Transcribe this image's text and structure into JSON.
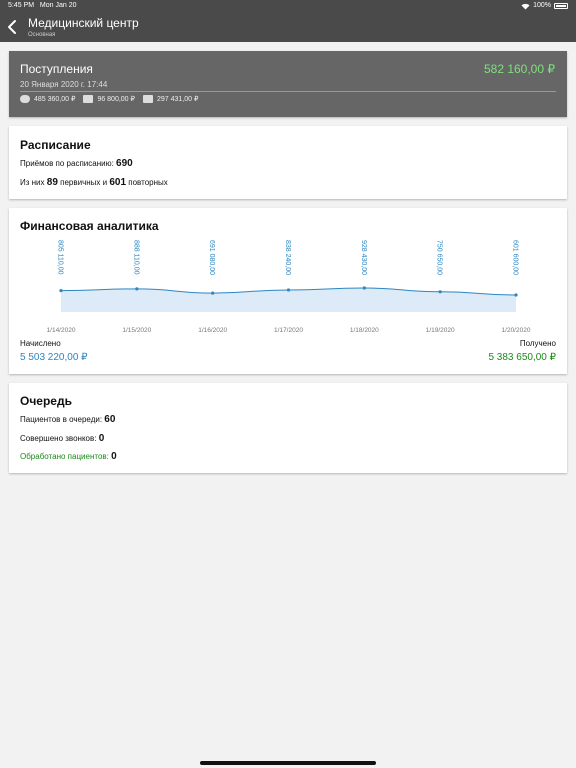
{
  "status": {
    "time": "5:45 PM",
    "date": "Mon Jan 20",
    "battery": "100%"
  },
  "nav": {
    "title": "Медицинский центр",
    "subtitle": "Основная"
  },
  "income": {
    "title": "Поступления",
    "date": "20 Января 2020 г. 17:44",
    "total": "582 160,00 ₽",
    "payments": [
      {
        "icon": "cash-icon",
        "amount": "485 360,00 ₽"
      },
      {
        "icon": "card-icon",
        "amount": "96 800,00 ₽"
      },
      {
        "icon": "invoice-icon",
        "amount": "297 431,00 ₽"
      }
    ]
  },
  "schedule": {
    "title": "Расписание",
    "appointments_prefix": "Приёмов по расписанию:",
    "appointments_value": "690",
    "split_prefix": "Из них",
    "primary_value": "89",
    "primary_label": "первичных и",
    "repeat_value": "601",
    "repeat_label": "повторных"
  },
  "analytics": {
    "title": "Финансовая аналитика",
    "accrued_label": "Начислено",
    "accrued_value": "5 503 220,00 ₽",
    "received_label": "Получено",
    "received_value": "5 383 650,00 ₽",
    "accrued_color": "#2e86c1",
    "received_color": "#1a8a1a"
  },
  "chart_data": {
    "type": "area",
    "x": [
      "1/14/2020",
      "1/15/2020",
      "1/16/2020",
      "1/17/2020",
      "1/18/2020",
      "1/19/2020",
      "1/20/2020"
    ],
    "values": [
      805110,
      888110,
      691080,
      838240,
      928430,
      750650,
      601600
    ],
    "value_labels": [
      "805 110,00",
      "888 110,00",
      "691 080,00",
      "838 240,00",
      "928 430,00",
      "750 650,00",
      "601 600,00"
    ],
    "line_color": "#2e86c1",
    "fill_color": "#dcebf7"
  },
  "queue": {
    "title": "Очередь",
    "in_queue_label": "Пациентов в очереди:",
    "in_queue_value": "60",
    "calls_label": "Совершено звонков:",
    "calls_value": "0",
    "processed_label": "Обработано пациентов:",
    "processed_value": "0",
    "processed_color": "#1a8a1a"
  }
}
